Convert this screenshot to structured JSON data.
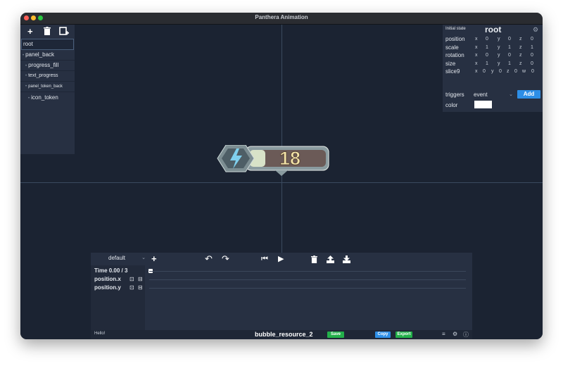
{
  "window": {
    "title": "Panthera Animation"
  },
  "tree": {
    "items": [
      {
        "label": "root"
      },
      {
        "label": "panel_back"
      },
      {
        "label": "progress_fill"
      },
      {
        "label": "text_progress"
      },
      {
        "label": "panel_token_back"
      },
      {
        "label": "icon_token"
      }
    ]
  },
  "inspector": {
    "caption": "Initial state",
    "node_name": "root",
    "rows": [
      {
        "label": "position",
        "values": [
          "x",
          "0",
          "y",
          "0",
          "z",
          "0"
        ]
      },
      {
        "label": "scale",
        "values": [
          "x",
          "1",
          "y",
          "1",
          "z",
          "1"
        ]
      },
      {
        "label": "rotation",
        "values": [
          "x",
          "0",
          "y",
          "0",
          "z",
          "0"
        ]
      },
      {
        "label": "size",
        "values": [
          "x",
          "1",
          "y",
          "1",
          "z",
          "0"
        ]
      },
      {
        "label": "slice9",
        "values": [
          "x",
          "0",
          "y",
          "0",
          "z",
          "0",
          "w",
          "0"
        ]
      }
    ],
    "triggers_label": "triggers",
    "trigger_value": "event",
    "add_label": "Add",
    "color_label": "color",
    "color_value": "#ffffff"
  },
  "preview": {
    "counter_text": "18"
  },
  "timeline": {
    "animation_name": "default",
    "time_label": "Time 0.00 / 3",
    "tracks": [
      {
        "label": "position.x"
      },
      {
        "label": "position.y"
      }
    ]
  },
  "statusbar": {
    "message": "Hello!",
    "file_name": "bubble_resource_2",
    "save_label": "Save",
    "copy_label": "Copy",
    "export_label": "Export"
  },
  "colors": {
    "accent_blue": "#2d8ee6",
    "save_green": "#23b04a",
    "canvas_bg": "#1b2332",
    "panel_bg": "#273042"
  }
}
